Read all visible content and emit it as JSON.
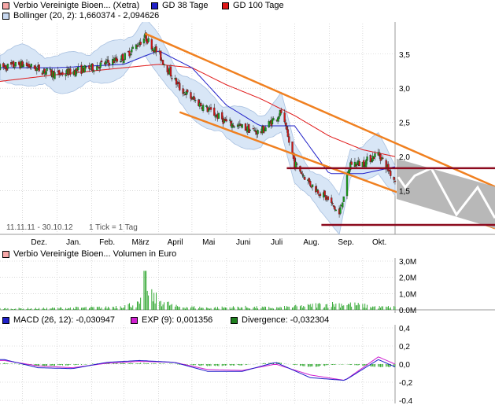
{
  "main": {
    "legend": [
      {
        "label": "Verbio Vereinigte Bioen... (Xetra)",
        "color": "#f7a8a8"
      },
      {
        "label": "GD 38 Tage",
        "color": "#2020c8"
      },
      {
        "label": "GD 100 Tage",
        "color": "#e01818"
      }
    ],
    "legend2": [
      {
        "label": "Bollinger (20, 2): 1,660374 - 2,094626",
        "color": "#c8d8f0"
      }
    ],
    "date_range": "11.11.11 - 30.10.12",
    "tick_info": "1 Tick = 1 Tag"
  },
  "volume": {
    "legend": [
      {
        "label": "Verbio Vereinigte Bioen... Volumen in Euro",
        "color": "#f7a8a8"
      }
    ]
  },
  "macd": {
    "legend": [
      {
        "label": "MACD (26, 12): -0,030947",
        "color": "#2020c8"
      },
      {
        "label": "EXP (9): 0,001356",
        "color": "#d020d0"
      },
      {
        "label": "Divergence: -0,032304",
        "color": "#208020"
      }
    ]
  },
  "colors": {
    "candle_up": "#18a018",
    "candle_down": "#d01818",
    "gd38": "#2020c8",
    "gd100": "#e01818",
    "bollinger_fill": "#d8e6f6",
    "bollinger_line": "#a8c0e0",
    "channel": "#f08020",
    "resistance": "#8c0a1e",
    "projection": "#b8b8b8",
    "volume_bar": "#20a020",
    "grid": "#c0c0c0"
  },
  "chart_data": [
    {
      "type": "line",
      "title": "Verbio Vereinigte Bioen... (Xetra)",
      "x_tick_labels": [
        "Dez.",
        "Jan.",
        "Feb.",
        "März",
        "April",
        "Mai",
        "Juni",
        "Juli",
        "Aug.",
        "Sep.",
        "Okt."
      ],
      "y_tick_labels": [
        "3,5",
        "3,0",
        "2,5",
        "2,0",
        "1,5"
      ],
      "ylim": [
        1.0,
        3.9
      ],
      "series": [
        {
          "name": "Verbio Vereinigte Bioen... (Xetra)",
          "x": [
            "2011-11-11",
            "2011-12-01",
            "2012-01-01",
            "2012-02-01",
            "2012-03-01",
            "2012-03-20",
            "2012-04-01",
            "2012-04-20",
            "2012-05-01",
            "2012-06-01",
            "2012-07-01",
            "2012-07-20",
            "2012-08-01",
            "2012-08-15",
            "2012-09-01",
            "2012-09-10",
            "2012-09-20",
            "2012-10-01",
            "2012-10-15",
            "2012-10-30"
          ],
          "values": [
            3.3,
            3.35,
            3.2,
            3.3,
            3.45,
            3.75,
            3.5,
            3.0,
            2.85,
            2.5,
            2.35,
            2.65,
            1.9,
            1.6,
            1.35,
            1.15,
            1.9,
            1.9,
            2.05,
            1.65
          ]
        },
        {
          "name": "GD 38 Tage",
          "x": [
            "2011-11-11",
            "2012-01-01",
            "2012-03-01",
            "2012-04-01",
            "2012-05-01",
            "2012-06-01",
            "2012-07-01",
            "2012-08-01",
            "2012-09-01",
            "2012-10-01",
            "2012-10-30"
          ],
          "values": [
            3.3,
            3.3,
            3.35,
            3.55,
            3.3,
            2.75,
            2.45,
            2.45,
            1.75,
            1.75,
            1.85
          ]
        },
        {
          "name": "GD 100 Tage",
          "x": [
            "2011-11-11",
            "2012-01-01",
            "2012-03-01",
            "2012-04-01",
            "2012-05-01",
            "2012-06-01",
            "2012-07-01",
            "2012-08-01",
            "2012-09-01",
            "2012-10-01",
            "2012-10-30"
          ],
          "values": [
            3.1,
            3.2,
            3.3,
            3.35,
            3.3,
            3.05,
            2.85,
            2.6,
            2.3,
            2.1,
            2.0
          ]
        }
      ]
    },
    {
      "type": "bar",
      "title": "Verbio Vereinigte Bioen... Volumen in Euro",
      "y_tick_labels": [
        "3,0M",
        "2,0M",
        "1,0M",
        "0,0M"
      ],
      "ylim": [
        0,
        3.0
      ],
      "series": [
        {
          "name": "Verbio Vereinigte Bioen... Volumen in Euro",
          "x": [
            "2011-12",
            "2012-01",
            "2012-02",
            "2012-03",
            "2012-03-20",
            "2012-04",
            "2012-05",
            "2012-06",
            "2012-07",
            "2012-08",
            "2012-08-15",
            "2012-09",
            "2012-10"
          ],
          "values": [
            0.2,
            0.3,
            0.35,
            0.9,
            2.4,
            0.5,
            0.3,
            0.4,
            0.3,
            0.6,
            0.7,
            0.9,
            0.4
          ]
        }
      ]
    },
    {
      "type": "line",
      "title": "MACD (26, 12)",
      "y_tick_labels": [
        "0,4",
        "0,2",
        "0,0",
        "-0,2",
        "-0,4"
      ],
      "ylim": [
        -0.4,
        0.4
      ],
      "series": [
        {
          "name": "MACD (26, 12): -0,030947",
          "x": [
            "2011-11",
            "2011-12",
            "2012-01",
            "2012-02",
            "2012-03",
            "2012-04",
            "2012-05",
            "2012-06",
            "2012-07",
            "2012-08",
            "2012-09",
            "2012-10",
            "2012-10-30"
          ],
          "values": [
            0.05,
            -0.04,
            -0.05,
            0.02,
            0.04,
            0.02,
            -0.08,
            -0.08,
            0.02,
            -0.15,
            -0.18,
            0.05,
            -0.03
          ]
        },
        {
          "name": "EXP (9): 0,001356",
          "x": [
            "2011-11",
            "2011-12",
            "2012-01",
            "2012-02",
            "2012-03",
            "2012-04",
            "2012-05",
            "2012-06",
            "2012-07",
            "2012-08",
            "2012-09",
            "2012-10",
            "2012-10-30"
          ],
          "values": [
            0.04,
            -0.02,
            -0.04,
            0.01,
            0.03,
            0.02,
            -0.06,
            -0.07,
            0.0,
            -0.12,
            -0.18,
            0.08,
            0.0
          ]
        },
        {
          "name": "Divergence: -0,032304",
          "x": [
            "2011-11",
            "2011-12",
            "2012-01",
            "2012-02",
            "2012-03",
            "2012-04",
            "2012-05",
            "2012-06",
            "2012-07",
            "2012-08",
            "2012-09",
            "2012-10",
            "2012-10-30"
          ],
          "values": [
            0.01,
            -0.02,
            -0.01,
            0.01,
            0.01,
            0.0,
            -0.02,
            -0.01,
            0.02,
            -0.03,
            0.0,
            -0.03,
            -0.03
          ]
        }
      ]
    }
  ]
}
